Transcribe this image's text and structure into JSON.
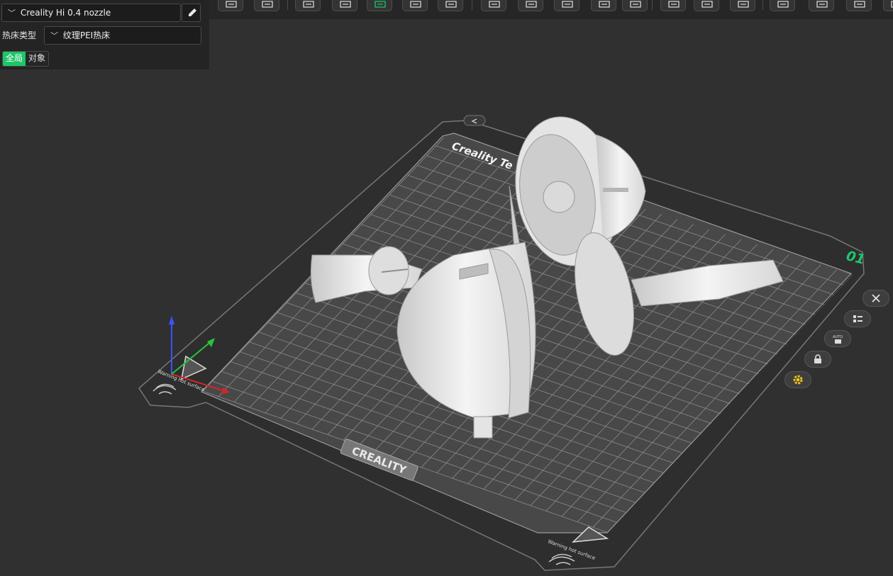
{
  "panel": {
    "printer": "Creality Hi 0.4 nozzle",
    "bed_type_label": "热床类型",
    "bed_type": "纹理PEI热床",
    "mode_global": "全局",
    "mode_object": "对象"
  },
  "toolbar": {
    "tools": [
      "add-cube",
      "arrange-grid",
      "orient",
      "lay-on-face",
      "auto-support",
      "split-plates",
      "cut",
      "layout",
      "drill",
      "scale",
      "measure",
      "boolean",
      "support-paint",
      "seam-paint",
      "color-paint",
      "text",
      "variable-height",
      "assembly",
      "slice-preview",
      "list"
    ]
  },
  "bed": {
    "brand_top": "Creality Te",
    "brand_front": "CREALITY",
    "warning_text": "Warning hot surface",
    "plate_number": "01"
  },
  "side_tools": [
    "close-icon",
    "plate-list-icon",
    "auto-icon",
    "lock-icon",
    "settings-gear-icon"
  ],
  "side_tools_text": {
    "auto": "AUTO"
  },
  "colors": {
    "accent": "#1ec569",
    "background": "#303031",
    "bed": "#454545",
    "grid": "#6a6a6a"
  }
}
